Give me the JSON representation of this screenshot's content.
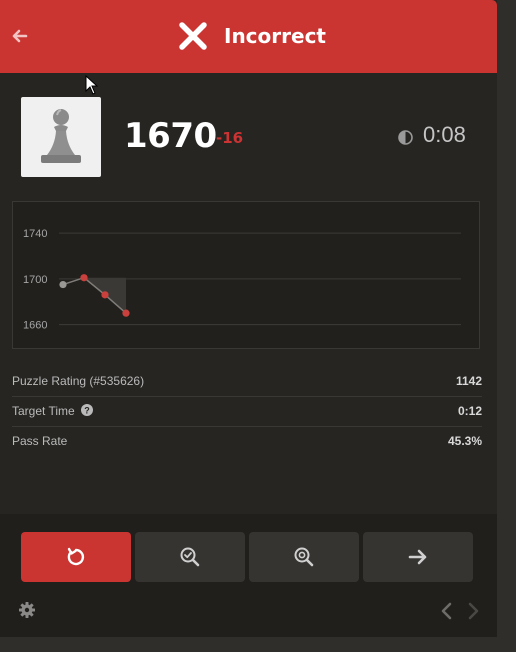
{
  "header": {
    "title": "Incorrect",
    "color": "#ca3431",
    "back_icon": "arrow-left-icon",
    "status_icon": "x-icon"
  },
  "player": {
    "avatar_icon": "pawn-icon",
    "rating": "1670",
    "rating_delta": "-16",
    "timer_icon": "half-circle-clock-icon",
    "time": "0:08"
  },
  "chart_data": {
    "type": "line",
    "y_ticks": [
      "1740",
      "1700",
      "1660"
    ],
    "ylim": [
      1650,
      1755
    ],
    "x": [
      0,
      1,
      2,
      3
    ],
    "series": [
      {
        "values": [
          1695,
          1701,
          1686,
          1670
        ]
      }
    ],
    "grid": true
  },
  "stats": [
    {
      "label": "Puzzle Rating (#535626)",
      "value": "1142"
    },
    {
      "label": "Target Time",
      "value": "0:12",
      "has_help": true
    },
    {
      "label": "Pass Rate",
      "value": "45.3%"
    }
  ],
  "toolbar": {
    "buttons": [
      {
        "name": "retry-button",
        "icon": "retry-icon",
        "color": "#ca3431"
      },
      {
        "name": "solution-button",
        "icon": "magnifier-check-icon"
      },
      {
        "name": "analysis-button",
        "icon": "magnifier-target-icon"
      },
      {
        "name": "next-button",
        "icon": "arrow-right-icon"
      }
    ]
  }
}
